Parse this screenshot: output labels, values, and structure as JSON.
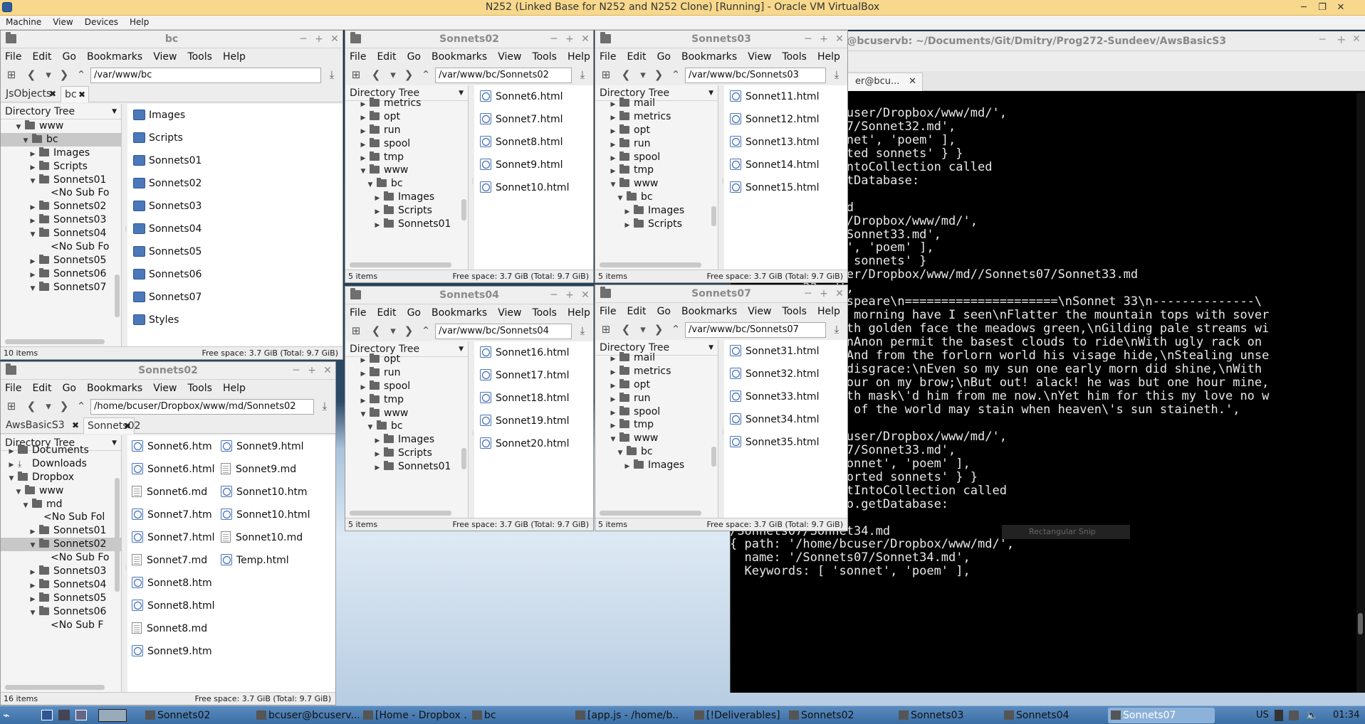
{
  "vbox": {
    "title": "N252 (Linked Base for N252 and N252 Clone) [Running] - Oracle VM VirtualBox",
    "menu": [
      "Machine",
      "View",
      "Devices",
      "Help"
    ]
  },
  "fm_menu": [
    "File",
    "Edit",
    "Go",
    "Bookmarks",
    "View",
    "Tools",
    "Help"
  ],
  "fm_bc": {
    "title": "bc",
    "path": "/var/www/bc",
    "tabs": [
      "JsObjects",
      "bc"
    ],
    "tree_header": "Directory Tree",
    "tree": [
      {
        "label": "www",
        "arrow": "▼",
        "indent": 20
      },
      {
        "label": "bc",
        "arrow": "▼",
        "indent": 30,
        "sel": true
      },
      {
        "label": "Images",
        "arrow": "▶",
        "indent": 40
      },
      {
        "label": "Scripts",
        "arrow": "▶",
        "indent": 40
      },
      {
        "label": "Sonnets01",
        "arrow": "▼",
        "indent": 40
      },
      {
        "label": "<No Sub Fo",
        "arrow": "",
        "indent": 70,
        "plain": true
      },
      {
        "label": "Sonnets02",
        "arrow": "▶",
        "indent": 40
      },
      {
        "label": "Sonnets03",
        "arrow": "▶",
        "indent": 40
      },
      {
        "label": "Sonnets04",
        "arrow": "▼",
        "indent": 40
      },
      {
        "label": "<No Sub Fo",
        "arrow": "",
        "indent": 70,
        "plain": true
      },
      {
        "label": "Sonnets05",
        "arrow": "▶",
        "indent": 40
      },
      {
        "label": "Sonnets06",
        "arrow": "▶",
        "indent": 40
      },
      {
        "label": "Sonnets07",
        "arrow": "▼",
        "indent": 40
      }
    ],
    "files": [
      "Images",
      "Scripts",
      "Sonnets01",
      "Sonnets02",
      "Sonnets03",
      "Sonnets04",
      "Sonnets05",
      "Sonnets06",
      "Sonnets07",
      "Styles"
    ],
    "items": "10 items",
    "free": "Free space: 3.7 GiB (Total: 9.7 GiB)"
  },
  "fm_s02_top": {
    "title": "Sonnets02",
    "path": "/var/www/bc/Sonnets02",
    "tree_header": "Directory Tree",
    "tree": [
      {
        "label": "metrics",
        "arrow": "▶",
        "indent": 20
      },
      {
        "label": "opt",
        "arrow": "▶",
        "indent": 20
      },
      {
        "label": "run",
        "arrow": "▶",
        "indent": 20
      },
      {
        "label": "spool",
        "arrow": "▶",
        "indent": 20
      },
      {
        "label": "tmp",
        "arrow": "▶",
        "indent": 20
      },
      {
        "label": "www",
        "arrow": "▼",
        "indent": 20
      },
      {
        "label": "bc",
        "arrow": "▼",
        "indent": 30
      },
      {
        "label": "Images",
        "arrow": "▶",
        "indent": 40
      },
      {
        "label": "Scripts",
        "arrow": "▶",
        "indent": 40
      },
      {
        "label": "Sonnets01",
        "arrow": "▶",
        "indent": 40
      }
    ],
    "files": [
      "Sonnet6.html",
      "Sonnet7.html",
      "Sonnet8.html",
      "Sonnet9.html",
      "Sonnet10.html"
    ],
    "items": "5 items",
    "free": "Free space: 3.7 GiB (Total: 9.7 GiB)"
  },
  "fm_s03": {
    "title": "Sonnets03",
    "path": "/var/www/bc/Sonnets03",
    "tree_header": "Directory Tree",
    "tree": [
      {
        "label": "mail",
        "arrow": "▶",
        "indent": 20
      },
      {
        "label": "metrics",
        "arrow": "▶",
        "indent": 20
      },
      {
        "label": "opt",
        "arrow": "▶",
        "indent": 20
      },
      {
        "label": "run",
        "arrow": "▶",
        "indent": 20
      },
      {
        "label": "spool",
        "arrow": "▶",
        "indent": 20
      },
      {
        "label": "tmp",
        "arrow": "▶",
        "indent": 20
      },
      {
        "label": "www",
        "arrow": "▼",
        "indent": 20
      },
      {
        "label": "bc",
        "arrow": "▼",
        "indent": 30
      },
      {
        "label": "Images",
        "arrow": "▶",
        "indent": 40
      },
      {
        "label": "Scripts",
        "arrow": "▶",
        "indent": 40
      }
    ],
    "files": [
      "Sonnet11.html",
      "Sonnet12.html",
      "Sonnet13.html",
      "Sonnet14.html",
      "Sonnet15.html"
    ],
    "items": "5 items",
    "free": "Free space: 3.7 GiB (Total: 9.7 GiB)"
  },
  "fm_s04": {
    "title": "Sonnets04",
    "path": "/var/www/bc/Sonnets04",
    "tree_header": "Directory Tree",
    "tree": [
      {
        "label": "opt",
        "arrow": "▶",
        "indent": 20
      },
      {
        "label": "run",
        "arrow": "▶",
        "indent": 20
      },
      {
        "label": "spool",
        "arrow": "▶",
        "indent": 20
      },
      {
        "label": "tmp",
        "arrow": "▶",
        "indent": 20
      },
      {
        "label": "www",
        "arrow": "▼",
        "indent": 20
      },
      {
        "label": "bc",
        "arrow": "▼",
        "indent": 30
      },
      {
        "label": "Images",
        "arrow": "▶",
        "indent": 40
      },
      {
        "label": "Scripts",
        "arrow": "▶",
        "indent": 40
      },
      {
        "label": "Sonnets01",
        "arrow": "▶",
        "indent": 40
      }
    ],
    "files": [
      "Sonnet16.html",
      "Sonnet17.html",
      "Sonnet18.html",
      "Sonnet19.html",
      "Sonnet20.html"
    ],
    "items": "5 items",
    "free": "Free space: 3.7 GiB (Total: 9.7 GiB)"
  },
  "fm_s07": {
    "title": "Sonnets07",
    "path": "/var/www/bc/Sonnets07",
    "tree_header": "Directory Tree",
    "tree": [
      {
        "label": "mail",
        "arrow": "▶",
        "indent": 20
      },
      {
        "label": "metrics",
        "arrow": "▶",
        "indent": 20
      },
      {
        "label": "opt",
        "arrow": "▶",
        "indent": 20
      },
      {
        "label": "run",
        "arrow": "▶",
        "indent": 20
      },
      {
        "label": "spool",
        "arrow": "▶",
        "indent": 20
      },
      {
        "label": "tmp",
        "arrow": "▶",
        "indent": 20
      },
      {
        "label": "www",
        "arrow": "▼",
        "indent": 20
      },
      {
        "label": "bc",
        "arrow": "▼",
        "indent": 30
      },
      {
        "label": "Images",
        "arrow": "▶",
        "indent": 40
      }
    ],
    "files": [
      "Sonnet31.html",
      "Sonnet32.html",
      "Sonnet33.html",
      "Sonnet34.html",
      "Sonnet35.html"
    ],
    "items": "5 items",
    "free": "Free space: 3.7 GiB (Total: 9.7 GiB)"
  },
  "fm_md": {
    "title": "Sonnets02",
    "path": "/home/bcuser/Dropbox/www/md/Sonnets02",
    "tabs": [
      "AwsBasicS3",
      "Sonnets02"
    ],
    "tree_header": "Directory Tree",
    "tree": [
      {
        "label": "Documents",
        "arrow": "▶",
        "indent": 10,
        "cut": true
      },
      {
        "label": "Downloads",
        "arrow": "▶",
        "indent": 10,
        "dl": true
      },
      {
        "label": "Dropbox",
        "arrow": "▼",
        "indent": 10
      },
      {
        "label": "www",
        "arrow": "▼",
        "indent": 20
      },
      {
        "label": "md",
        "arrow": "▼",
        "indent": 30
      },
      {
        "label": "<No Sub Fol",
        "arrow": "",
        "indent": 60,
        "plain": true
      },
      {
        "label": "Sonnets01",
        "arrow": "▶",
        "indent": 40
      },
      {
        "label": "Sonnets02",
        "arrow": "▼",
        "indent": 40,
        "sel": true
      },
      {
        "label": "<No Sub Fo",
        "arrow": "",
        "indent": 70,
        "plain": true
      },
      {
        "label": "Sonnets03",
        "arrow": "▶",
        "indent": 40
      },
      {
        "label": "Sonnets04",
        "arrow": "▶",
        "indent": 40
      },
      {
        "label": "Sonnets05",
        "arrow": "▶",
        "indent": 40
      },
      {
        "label": "Sonnets06",
        "arrow": "▼",
        "indent": 40
      },
      {
        "label": "<No Sub F",
        "arrow": "",
        "indent": 70,
        "plain": true
      }
    ],
    "files_col1": [
      {
        "name": "Sonnet6.htm",
        "kind": "html"
      },
      {
        "name": "Sonnet6.html",
        "kind": "html"
      },
      {
        "name": "Sonnet6.md",
        "kind": "md"
      },
      {
        "name": "Sonnet7.htm",
        "kind": "html"
      },
      {
        "name": "Sonnet7.html",
        "kind": "html"
      },
      {
        "name": "Sonnet7.md",
        "kind": "md"
      },
      {
        "name": "Sonnet8.htm",
        "kind": "html"
      },
      {
        "name": "Sonnet8.html",
        "kind": "html"
      },
      {
        "name": "Sonnet8.md",
        "kind": "md"
      },
      {
        "name": "Sonnet9.htm",
        "kind": "html"
      }
    ],
    "files_col2": [
      {
        "name": "Sonnet9.html",
        "kind": "html"
      },
      {
        "name": "Sonnet9.md",
        "kind": "md"
      },
      {
        "name": "Sonnet10.htm",
        "kind": "html"
      },
      {
        "name": "Sonnet10.html",
        "kind": "html"
      },
      {
        "name": "Sonnet10.md",
        "kind": "md"
      },
      {
        "name": "Temp.html",
        "kind": "html"
      }
    ],
    "items": "16 items",
    "free": "Free space: 3.7 GiB (Total: 9.7 GiB)"
  },
  "terminal": {
    "title": "er@bcuservb: ~/Documents/Git/Dmitry/Prog272-Sundeev/AwsBasicS3",
    "tab": "er@bcu...",
    "snip_label": "Rectangular Snip",
    "lines": [
      "",
      "          ome/bcuser/Dropbox/www/md/',",
      "          nnets07/Sonnet32.md',",
      "          [ 'sonnet', 'poem' ],",
      "          'Imported sonnets' } }",
      "          nsertIntoCollection called",
      "          ngo.getDatabase:",
      "",
      "          et33.md",
      "          bcuser/Dropbox/www/md/',",
      "          ets07/Sonnet33.md',",
      "          sonnet', 'poem' ],",
      "          ported sonnets' }",
      "          e/bcuser/Dropbox/www/md//Sonnets07/Sonnet33.md",
      "          33.md',",
      "          'Shakespeare\\n=====================\\nSonnet 33\\n--------------\\",
      "          orious morning have I seen\\nFlatter the mountain tops with sover",
      "          ing with golden face the meadows green,\\nGilding pale streams wi",
      "          hemy;\\nAnon permit the basest clouds to ride\\nWith ugly rack on",
      "          ace,\\nAnd from the forlorn world his visage hide,\\nStealing unse",
      "           this disgrace:\\nEven so my sun one early morn did shine,\\nWith",
      "          splendour on my brow;\\nBut out! alack! he was but one hour mine,",
      "          oud hath mask\\'d him from me now.\\nYet him for this my love no w",
      "          \\nSuns of the world may stain when heaven\\'s sun staineth.',",
      "",
      "          ome/bcuser/Dropbox/www/md/',",
      "          nnets07/Sonnet33.md',",
      "  Keywords: [ 'sonnet', 'poem' ],",
      "  comments: 'Imported sonnets' } }",
      "QueryMongo.insertIntoCollection called",
      "Called QueryMongo.getDatabase:",
      "database exists",
      "/Sonnets07/Sonnet34.md",
      "{ path: '/home/bcuser/Dropbox/www/md/',",
      "  name: '/Sonnets07/Sonnet34.md',",
      "  Keywords: [ 'sonnet', 'poem' ],"
    ]
  },
  "taskbar": {
    "items": [
      {
        "label": "Sonnets02",
        "active": false
      },
      {
        "label": "bcuser@bcuserv...",
        "active": false
      },
      {
        "label": "[Home - Dropbox ...",
        "active": false
      },
      {
        "label": "bc",
        "active": false
      },
      {
        "label": "[app.js - /home/b...",
        "active": false
      },
      {
        "label": "[!Deliverables]",
        "active": false
      },
      {
        "label": "Sonnets02",
        "active": false
      },
      {
        "label": "Sonnets03",
        "active": false
      },
      {
        "label": "Sonnets04",
        "active": false
      },
      {
        "label": "Sonnets07",
        "active": true
      }
    ],
    "lang": "US",
    "clock": "01:34"
  }
}
